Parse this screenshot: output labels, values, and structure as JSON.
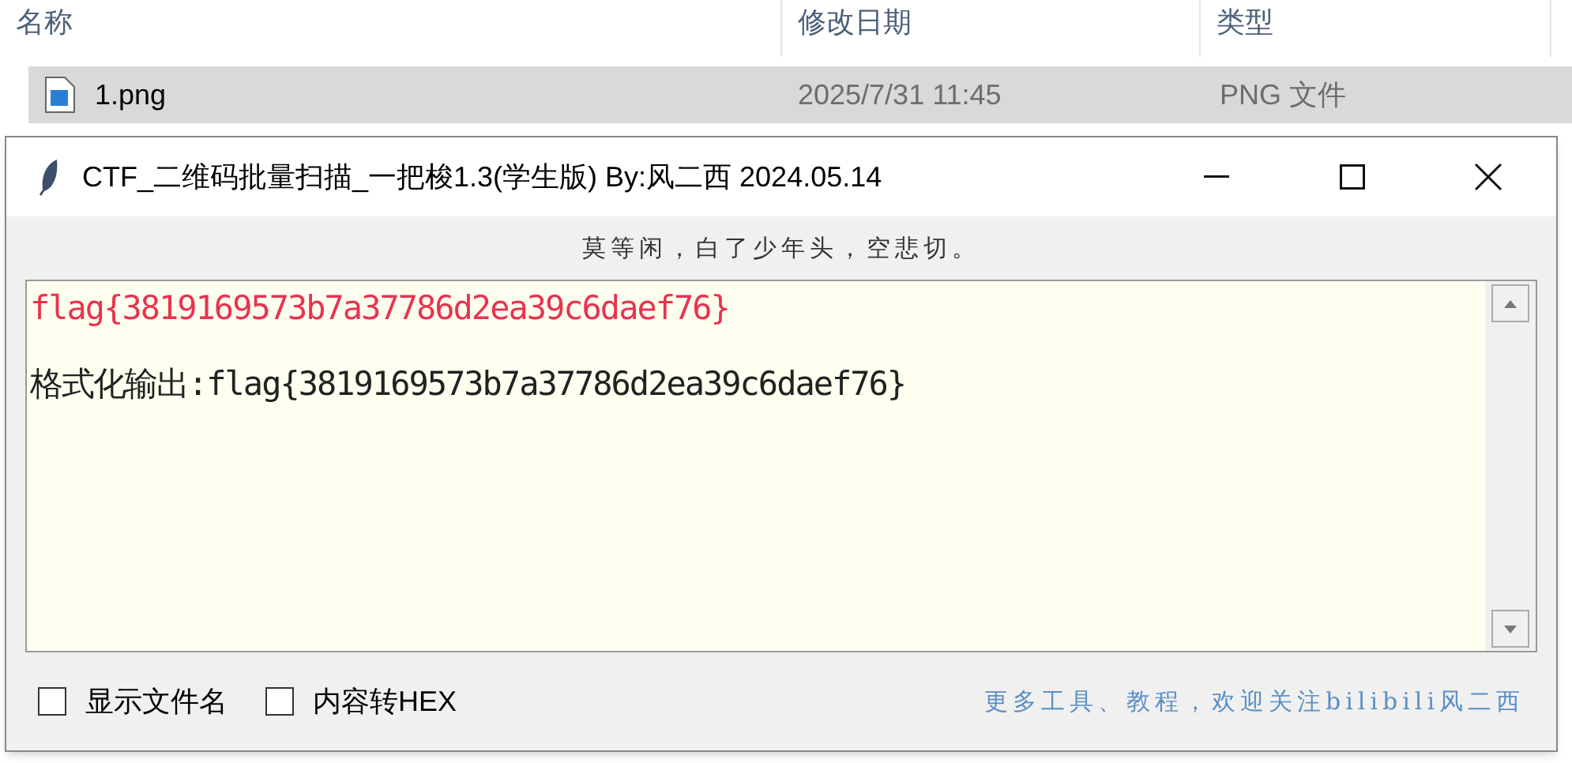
{
  "explorer": {
    "columns": [
      "名称",
      "修改日期",
      "类型"
    ],
    "rows": [
      {
        "name": "1.png",
        "modified": "2025/7/31 11:45",
        "type": "PNG 文件",
        "selected": true
      }
    ]
  },
  "window": {
    "title": "CTF_二维码批量扫描_一把梭1.3(学生版)  By:风二西 2024.05.14",
    "motto": "莫等闲，白了少年头，空悲切。",
    "output": [
      {
        "kind": "flag",
        "text": "flag{3819169573b7a37786d2ea39c6daef76}"
      },
      {
        "kind": "formatted",
        "text": "格式化输出:flag{3819169573b7a37786d2ea39c6daef76}"
      }
    ],
    "options": [
      {
        "label": "显示文件名",
        "checked": false
      },
      {
        "label": "内容转HEX",
        "checked": false
      }
    ],
    "footer": "更多工具、教程，欢迎关注bilibili风二西"
  }
}
